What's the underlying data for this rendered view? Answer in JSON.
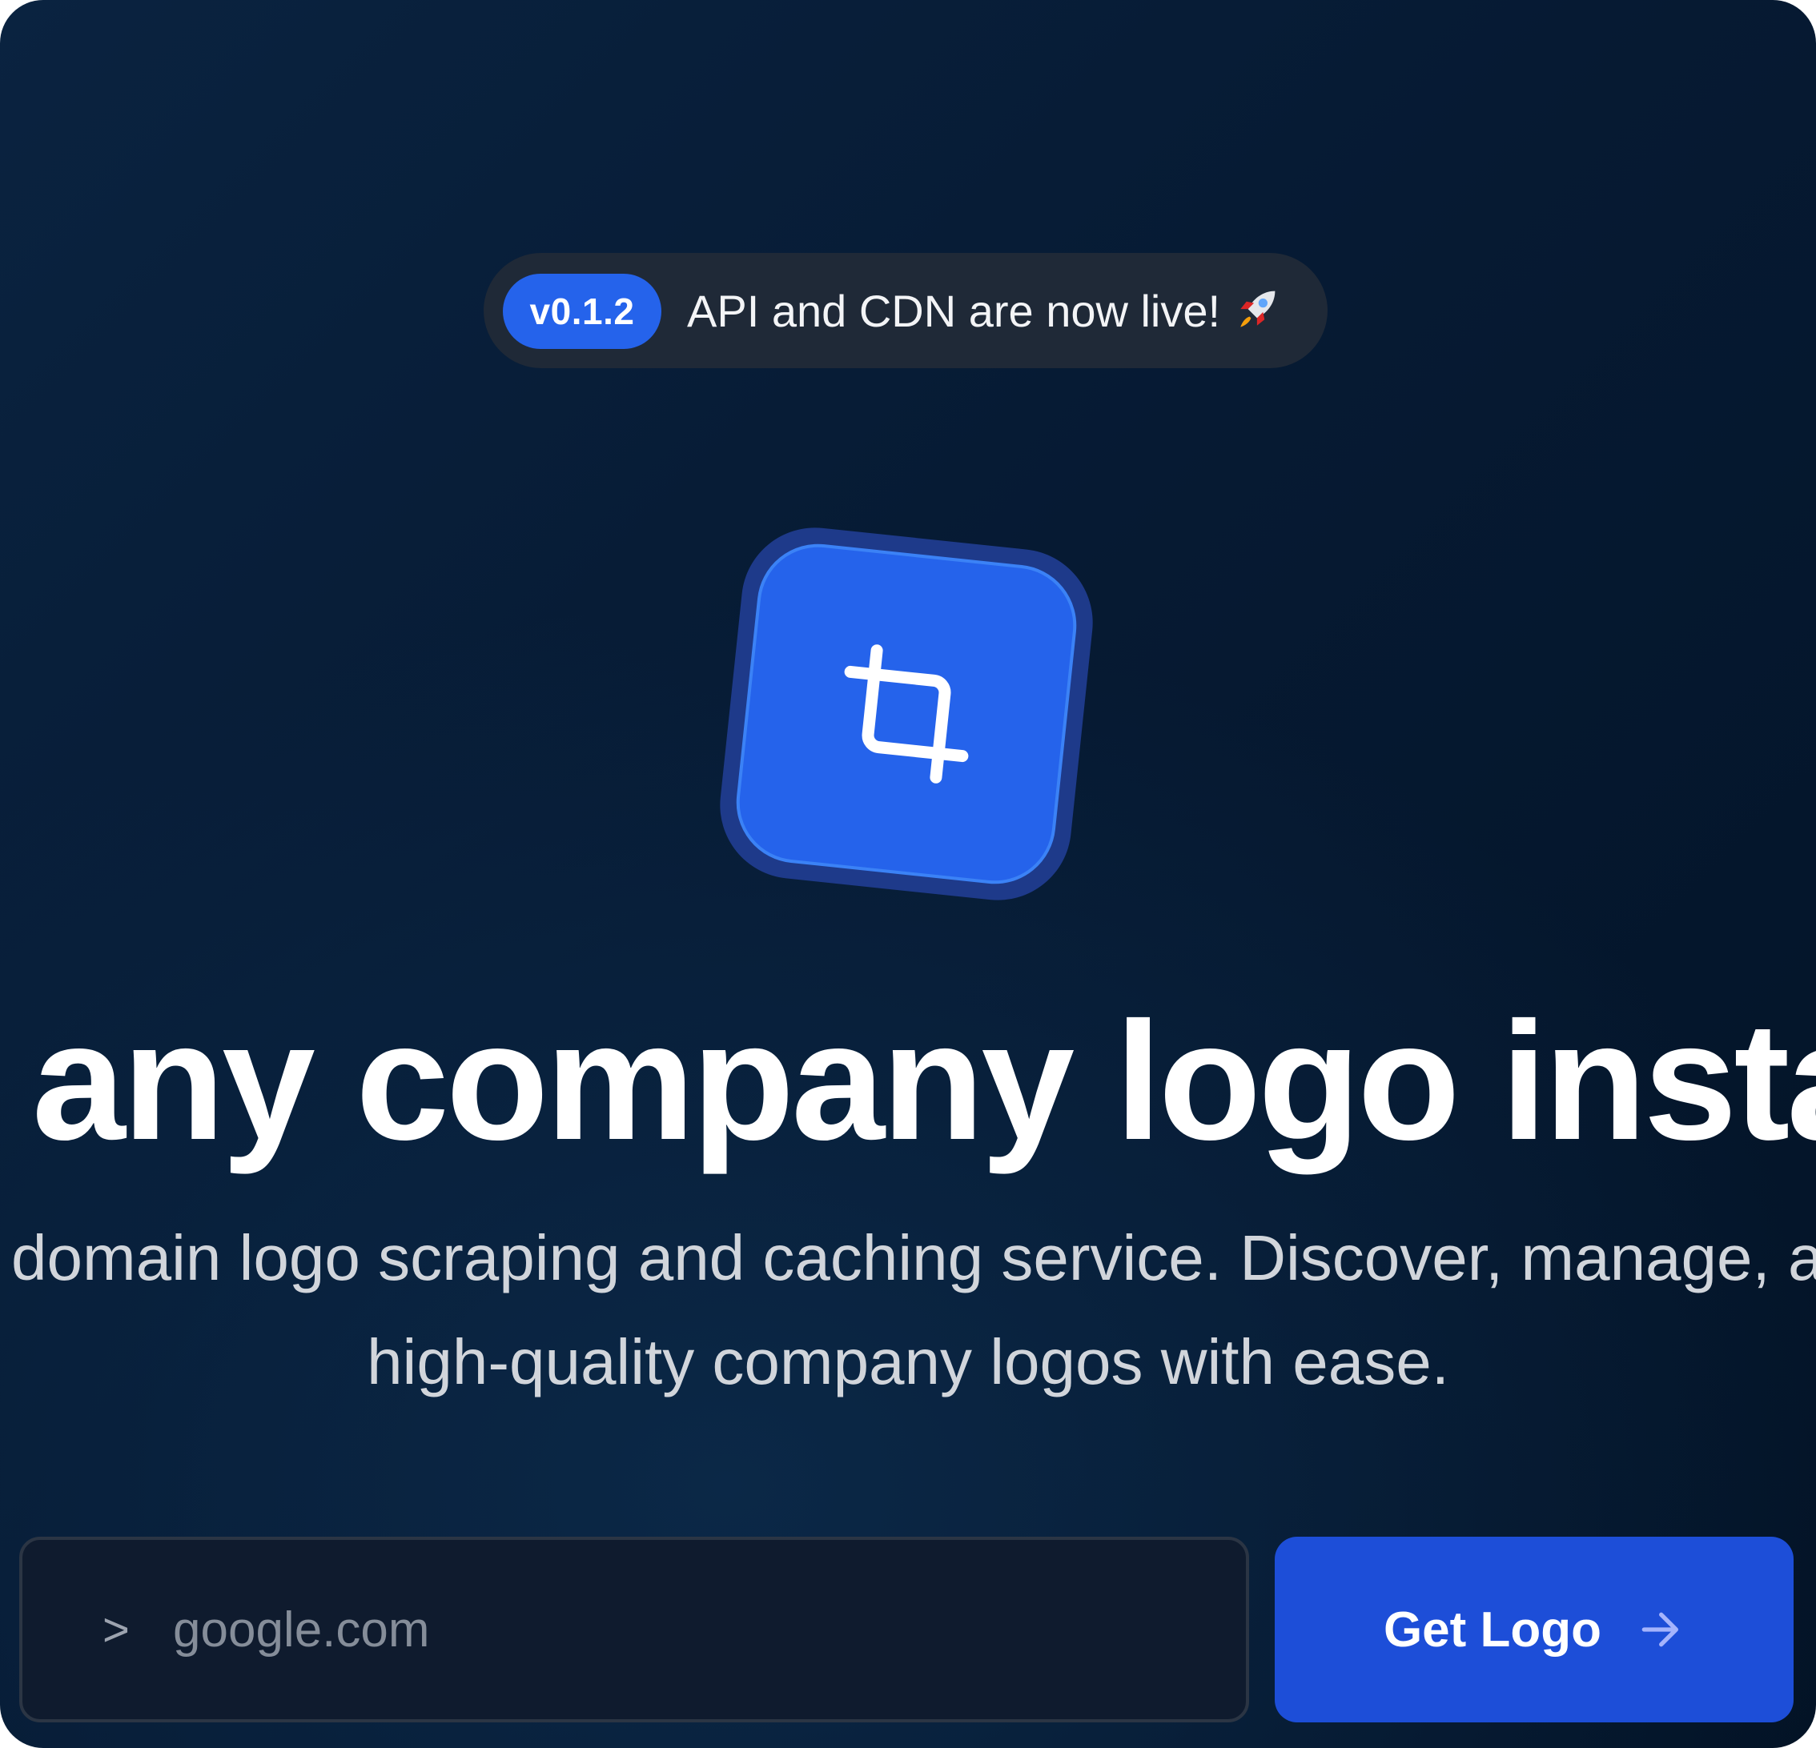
{
  "announcement": {
    "version": "v0.1.2",
    "text": "API and CDN are now live!",
    "icon": "rocket-icon"
  },
  "logo": {
    "icon": "crop-icon",
    "accent": "#2563eb"
  },
  "hero": {
    "headline": "any company logo instar",
    "subtitle_line1": "domain logo scraping and caching service. Discover, manage, a",
    "subtitle_line2": "high-quality company logos with ease."
  },
  "search": {
    "prompt_symbol": ">",
    "placeholder": "google.com",
    "value": ""
  },
  "cta": {
    "label": "Get Logo",
    "icon": "arrow-right-icon",
    "color": "#1d4ed8"
  }
}
